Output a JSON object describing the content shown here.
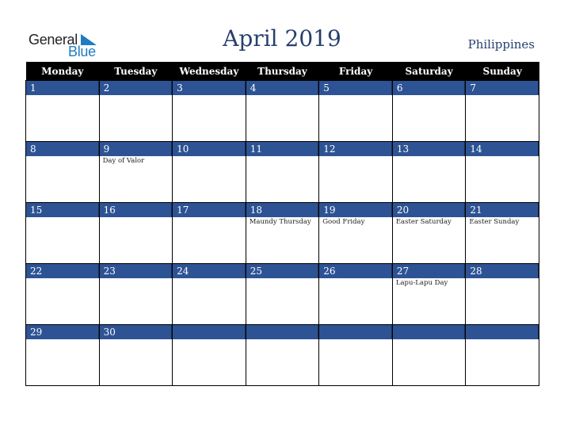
{
  "logo": {
    "line1": "General",
    "line2": "Blue"
  },
  "title": "April 2019",
  "country": "Philippines",
  "colors": {
    "header_bg": "#000000",
    "day_bar": "#2d5394",
    "title": "#263f6e",
    "logo_blue": "#1f7cc2"
  },
  "weekdays": [
    "Monday",
    "Tuesday",
    "Wednesday",
    "Thursday",
    "Friday",
    "Saturday",
    "Sunday"
  ],
  "weeks": [
    [
      {
        "day": "1",
        "holiday": ""
      },
      {
        "day": "2",
        "holiday": ""
      },
      {
        "day": "3",
        "holiday": ""
      },
      {
        "day": "4",
        "holiday": ""
      },
      {
        "day": "5",
        "holiday": ""
      },
      {
        "day": "6",
        "holiday": ""
      },
      {
        "day": "7",
        "holiday": ""
      }
    ],
    [
      {
        "day": "8",
        "holiday": ""
      },
      {
        "day": "9",
        "holiday": "Day of Valor"
      },
      {
        "day": "10",
        "holiday": ""
      },
      {
        "day": "11",
        "holiday": ""
      },
      {
        "day": "12",
        "holiday": ""
      },
      {
        "day": "13",
        "holiday": ""
      },
      {
        "day": "14",
        "holiday": ""
      }
    ],
    [
      {
        "day": "15",
        "holiday": ""
      },
      {
        "day": "16",
        "holiday": ""
      },
      {
        "day": "17",
        "holiday": ""
      },
      {
        "day": "18",
        "holiday": "Maundy Thursday"
      },
      {
        "day": "19",
        "holiday": "Good Friday"
      },
      {
        "day": "20",
        "holiday": "Easter Saturday"
      },
      {
        "day": "21",
        "holiday": "Easter Sunday"
      }
    ],
    [
      {
        "day": "22",
        "holiday": ""
      },
      {
        "day": "23",
        "holiday": ""
      },
      {
        "day": "24",
        "holiday": ""
      },
      {
        "day": "25",
        "holiday": ""
      },
      {
        "day": "26",
        "holiday": ""
      },
      {
        "day": "27",
        "holiday": "Lapu-Lapu Day"
      },
      {
        "day": "28",
        "holiday": ""
      }
    ],
    [
      {
        "day": "29",
        "holiday": ""
      },
      {
        "day": "30",
        "holiday": ""
      },
      {
        "day": "",
        "holiday": ""
      },
      {
        "day": "",
        "holiday": ""
      },
      {
        "day": "",
        "holiday": ""
      },
      {
        "day": "",
        "holiday": ""
      },
      {
        "day": "",
        "holiday": ""
      }
    ]
  ]
}
